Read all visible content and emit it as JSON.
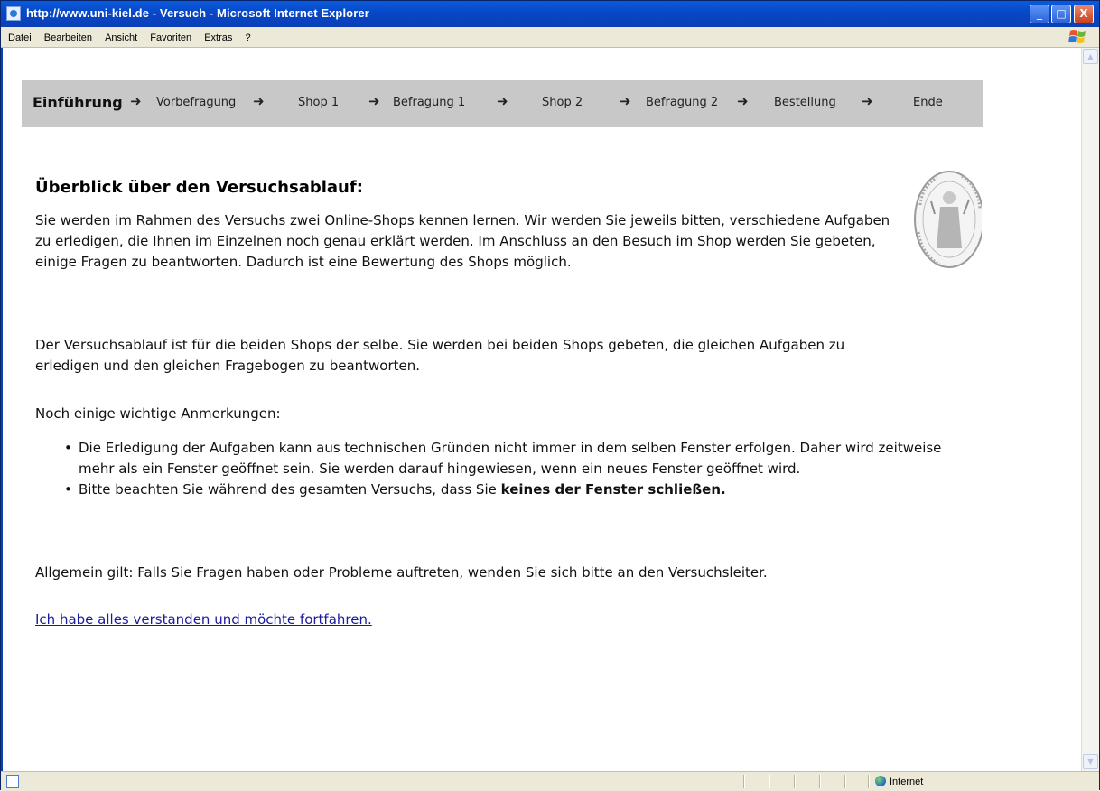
{
  "window": {
    "title": "http://www.uni-kiel.de - Versuch - Microsoft Internet Explorer",
    "controls": {
      "minimize": "_",
      "maximize": "□",
      "close": "X"
    }
  },
  "menu": [
    "Datei",
    "Bearbeiten",
    "Ansicht",
    "Favoriten",
    "Extras",
    "?"
  ],
  "nav": {
    "steps": [
      "Einführung",
      "Vorbefragung",
      "Shop 1",
      "Befragung 1",
      "Shop 2",
      "Befragung 2",
      "Bestellung",
      "Ende"
    ],
    "arrow": "➜",
    "current": "Einführung"
  },
  "page": {
    "heading": "Überblick über den Versuchsablauf:",
    "para1": "Sie werden im Rahmen des Versuchs zwei Online-Shops kennen lernen. Wir werden Sie jeweils bitten, verschiedene Aufgaben zu erledigen, die Ihnen im Einzelnen noch genau erklärt werden. Im Anschluss an den Besuch im Shop werden Sie gebeten, einige Fragen zu beantworten. Dadurch ist eine Bewertung des Shops möglich.",
    "para2": "Der Versuchsablauf ist für die beiden Shops der selbe. Sie werden bei beiden Shops gebeten, die gleichen Aufgaben zu erledigen und den gleichen Fragebogen zu beantworten.",
    "para3": "Noch einige wichtige Anmerkungen:",
    "bullet1": "Die Erledigung der Aufgaben kann aus technischen Gründen nicht immer in dem selben Fenster erfolgen. Daher wird zeitweise mehr als ein Fenster geöffnet sein. Sie werden darauf hingewiesen, wenn ein neues Fenster geöffnet wird.",
    "bullet2_prefix": "Bitte beachten Sie während des gesamten Versuchs, dass Sie ",
    "bullet2_bold": "keines der Fenster schließen.",
    "para4": "Allgemein gilt: Falls Sie Fragen haben oder Probleme auftreten, wenden Sie sich bitte an den Versuchsleiter.",
    "continue_link": "Ich habe alles verstanden und möchte fortfahren."
  },
  "status": {
    "zone": "Internet"
  },
  "colors": {
    "titlebar": "#0847c5",
    "nav_bg": "#c8c8c8",
    "link": "#1a1a9c"
  }
}
